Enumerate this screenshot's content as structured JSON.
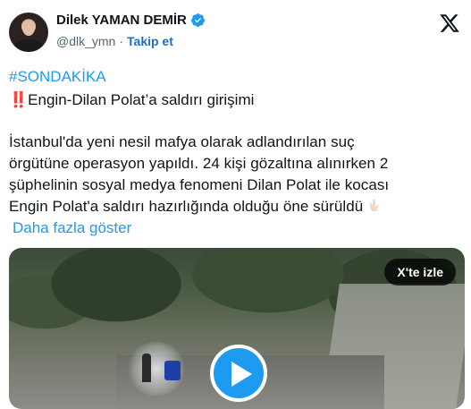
{
  "author": {
    "name": "Dilek YAMAN DEMİR",
    "handle": "@dlk_ymn",
    "separator": "·",
    "follow_label": "Takip et"
  },
  "tweet": {
    "hashtag": "#SONDAKİKA",
    "headline_marker": "‼️",
    "headline": "Engin-Dilan Polat’a saldırı girişimi",
    "body_line1": "İstanbul'da yeni nesil mafya olarak adlandırılan suç",
    "body_line2": "örgütüne operasyon yapıldı. 24 kişi gözaltına alınırken 2",
    "body_line3": "şüphelinin sosyal medya fenomeni Dilan Polat ile kocası",
    "body_line4": "Engin Polat'a saldırı hazırlığında olduğu öne sürüldü",
    "show_more": "Daha fazla göster"
  },
  "media": {
    "watch_on_x_label": "X'te izle"
  },
  "icons": {
    "verified": "verified-badge-icon",
    "brand": "x-logo-icon",
    "play": "play-icon",
    "pointing": "pointing-down-emoji-icon"
  },
  "colors": {
    "link": "#1d9bf0",
    "follow": "#1d6fc2",
    "text": "#0f1419",
    "muted": "#536471",
    "alert": "#d7263d"
  }
}
